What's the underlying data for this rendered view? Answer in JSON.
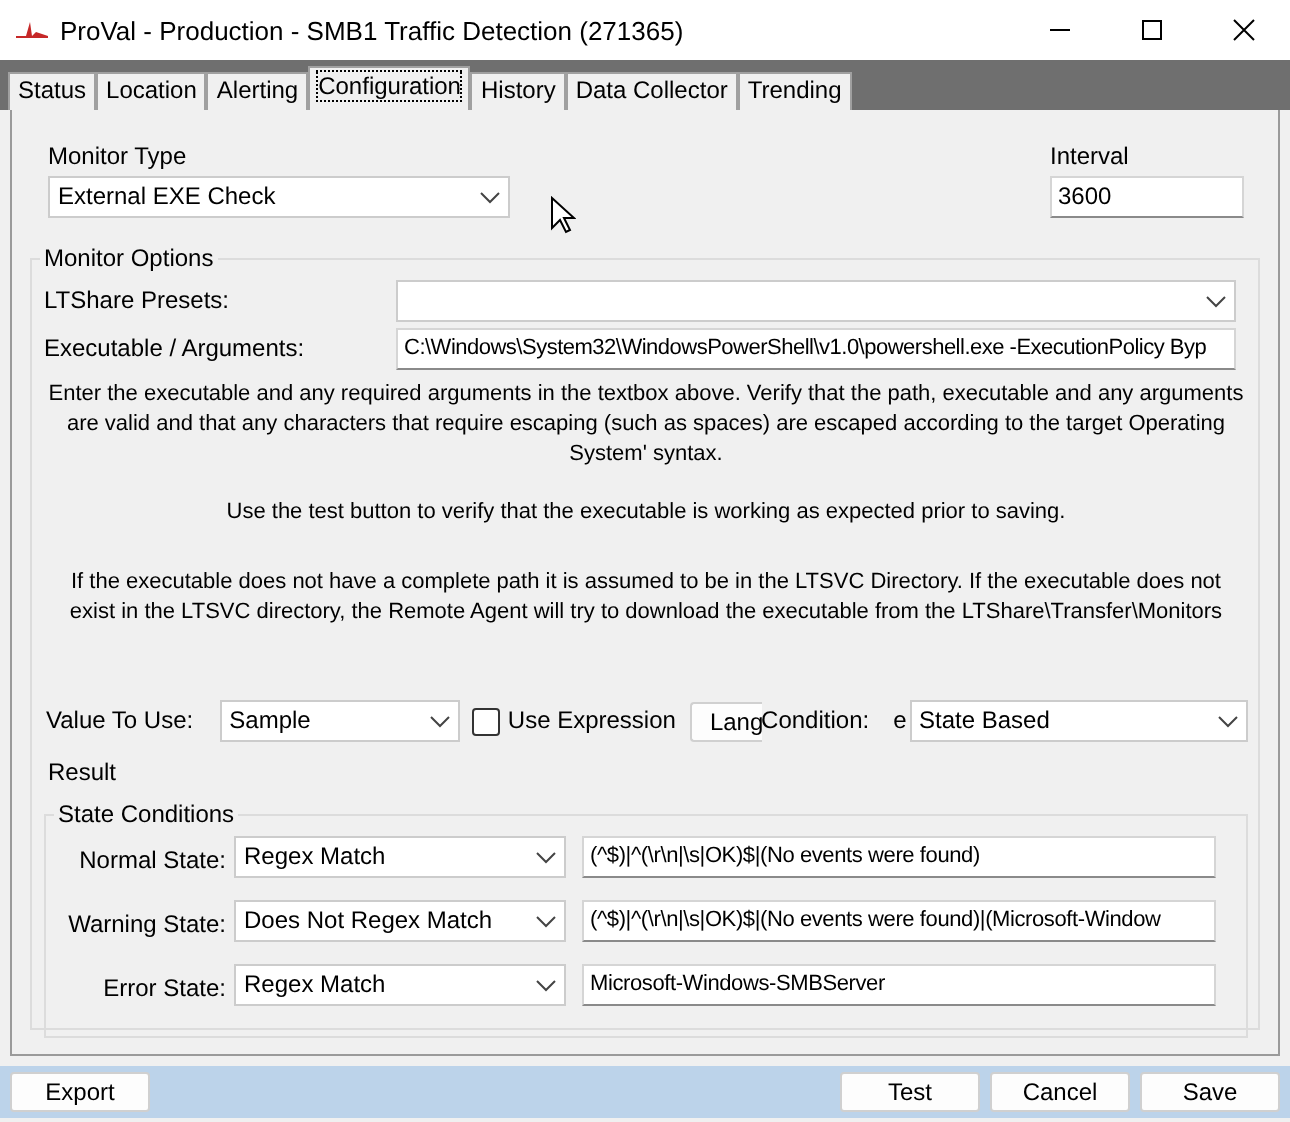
{
  "window": {
    "title": "ProVal - Production - SMB1 Traffic Detection (271365)"
  },
  "tabs": [
    {
      "label": "Status",
      "selected": false
    },
    {
      "label": "Location",
      "selected": false
    },
    {
      "label": "Alerting",
      "selected": false
    },
    {
      "label": "Configuration",
      "selected": true
    },
    {
      "label": "History",
      "selected": false
    },
    {
      "label": "Data Collector",
      "selected": false
    },
    {
      "label": "Trending",
      "selected": false
    }
  ],
  "monitor_type": {
    "label": "Monitor Type",
    "value": "External EXE Check"
  },
  "interval": {
    "label": "Interval",
    "value": "3600"
  },
  "monitor_options": {
    "title": "Monitor Options",
    "ltshare_presets": {
      "label": "LTShare Presets:"
    },
    "executable": {
      "label": "Executable / Arguments:",
      "value": "C:\\Windows\\System32\\WindowsPowerShell\\v1.0\\powershell.exe -ExecutionPolicy Byp"
    },
    "help": [
      "Enter the executable and any required arguments in the textbox above. Verify that the path, executable and any arguments are valid and that any characters that require escaping (such as spaces) are escaped according to the target Operating System' syntax.",
      "Use the test button to verify that the executable is working as expected prior to saving.",
      "If the executable does not have a complete path it is assumed to be in the LTSVC Directory. If the executable does not exist in the LTSVC directory, the Remote Agent will try to download the executable from the LTShare\\Transfer\\Monitors"
    ],
    "value_to_use": {
      "label": "Value To Use:",
      "value": "Sample"
    },
    "use_expression": {
      "label": "Use Expression",
      "checked": false
    },
    "lang_button": "Lang",
    "condition": {
      "label": "Condition:",
      "clipped": "e",
      "value": "State Based"
    },
    "result_label": "Result",
    "state_conditions": {
      "title": "State Conditions",
      "rows": [
        {
          "label": "Normal State:",
          "operator": "Regex Match",
          "value": "(^$)|^(\\r\\n|\\s|OK)$|(No events were found)"
        },
        {
          "label": "Warning State:",
          "operator": "Does Not Regex Match",
          "value": "(^$)|^(\\r\\n|\\s|OK)$|(No events were found)|(Microsoft-Window"
        },
        {
          "label": "Error State:",
          "operator": "Regex Match",
          "value": "Microsoft-Windows-SMBServer"
        }
      ]
    }
  },
  "buttons_left": [
    "Export"
  ],
  "buttons_right": [
    "Test",
    "Cancel",
    "Save"
  ]
}
